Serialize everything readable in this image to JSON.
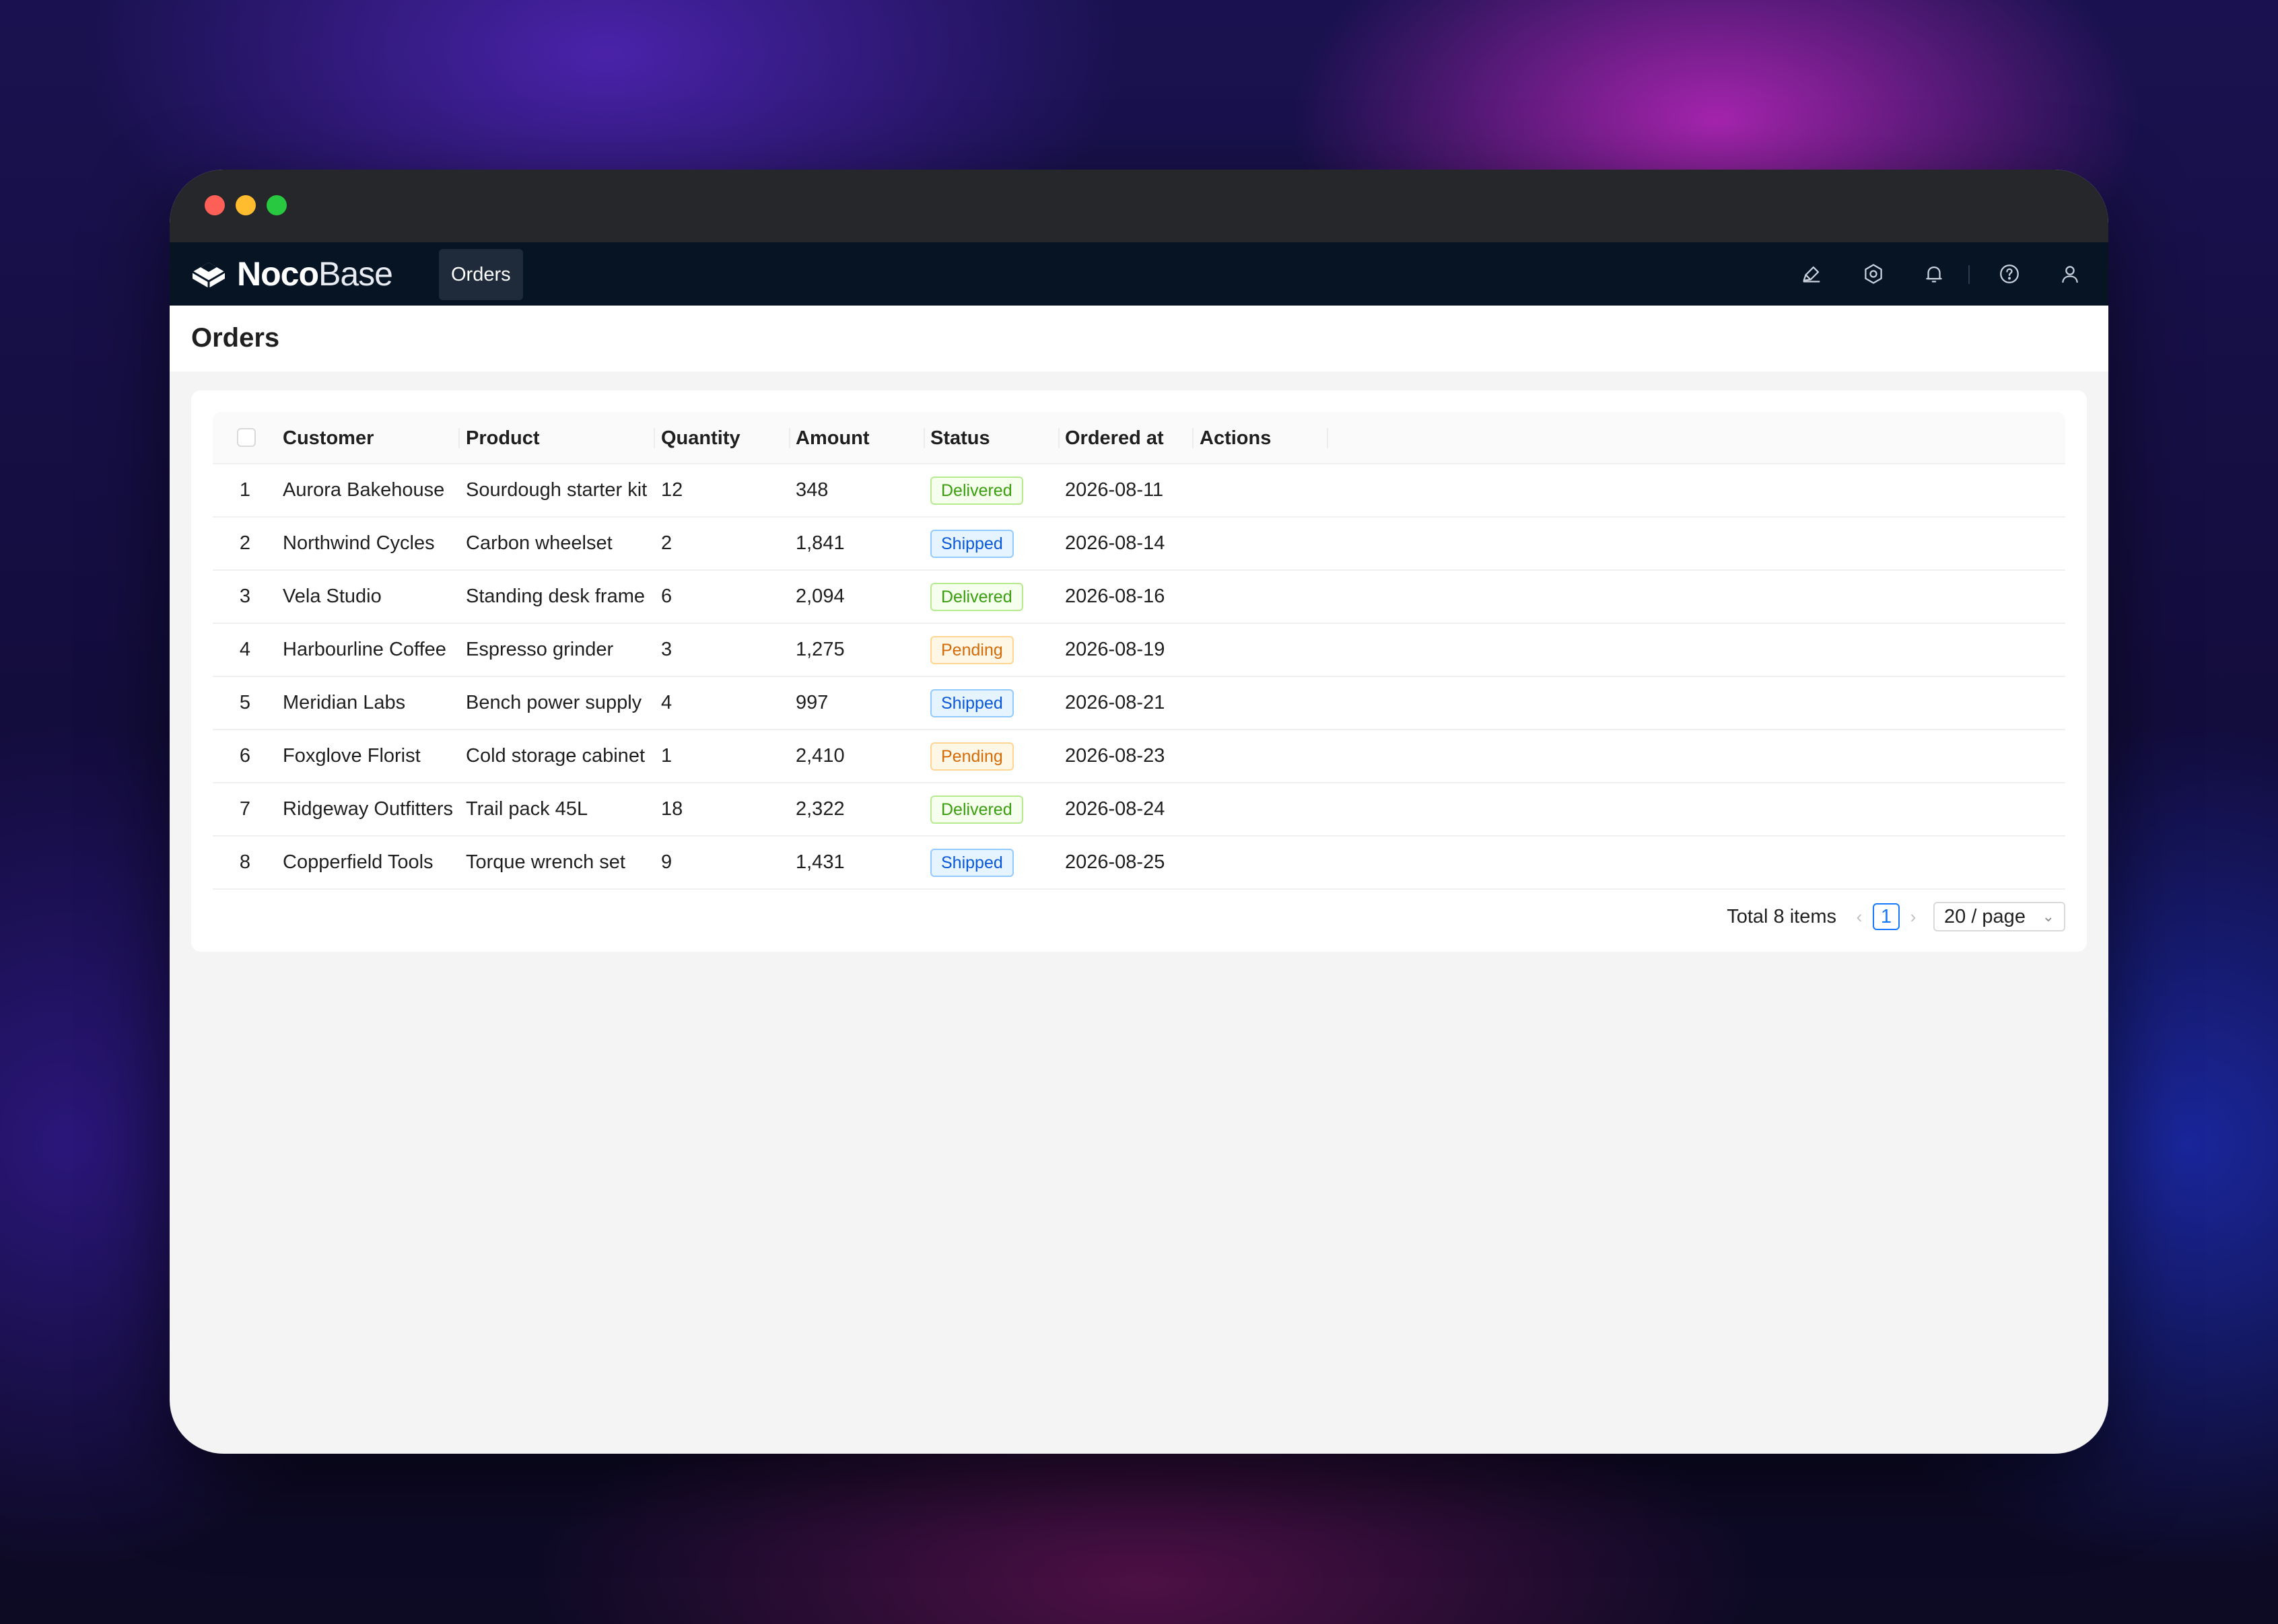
{
  "app": {
    "logo_noco": "Noco",
    "logo_base": "Base",
    "nav_tab": "Orders",
    "icons": [
      "brush-icon",
      "gear-icon",
      "bell-icon",
      "help-icon",
      "user-icon"
    ]
  },
  "page": {
    "title": "Orders"
  },
  "table": {
    "columns": [
      "Customer",
      "Product",
      "Quantity",
      "Amount",
      "Status",
      "Ordered at",
      "Actions"
    ],
    "rows": [
      {
        "index": "1",
        "customer": "Aurora Bakehouse",
        "product": "Sourdough starter kit",
        "quantity": "12",
        "amount": "348",
        "status": "Delivered",
        "ordered_at": "2026-08-11"
      },
      {
        "index": "2",
        "customer": "Northwind Cycles",
        "product": "Carbon wheelset",
        "quantity": "2",
        "amount": "1,841",
        "status": "Shipped",
        "ordered_at": "2026-08-14"
      },
      {
        "index": "3",
        "customer": "Vela Studio",
        "product": "Standing desk frame",
        "quantity": "6",
        "amount": "2,094",
        "status": "Delivered",
        "ordered_at": "2026-08-16"
      },
      {
        "index": "4",
        "customer": "Harbourline Coffee",
        "product": "Espresso grinder",
        "quantity": "3",
        "amount": "1,275",
        "status": "Pending",
        "ordered_at": "2026-08-19"
      },
      {
        "index": "5",
        "customer": "Meridian Labs",
        "product": "Bench power supply",
        "quantity": "4",
        "amount": "997",
        "status": "Shipped",
        "ordered_at": "2026-08-21"
      },
      {
        "index": "6",
        "customer": "Foxglove Florist",
        "product": "Cold storage cabinet",
        "quantity": "1",
        "amount": "2,410",
        "status": "Pending",
        "ordered_at": "2026-08-23"
      },
      {
        "index": "7",
        "customer": "Ridgeway Outfitters",
        "product": "Trail pack 45L",
        "quantity": "18",
        "amount": "2,322",
        "status": "Delivered",
        "ordered_at": "2026-08-24"
      },
      {
        "index": "8",
        "customer": "Copperfield Tools",
        "product": "Torque wrench set",
        "quantity": "9",
        "amount": "1,431",
        "status": "Shipped",
        "ordered_at": "2026-08-25"
      }
    ]
  },
  "pagination": {
    "total": "Total 8 items",
    "current_page": "1",
    "page_size": "20 / page"
  },
  "colors": {
    "delivered": "#389e0d",
    "shipped": "#0958d9",
    "pending": "#d46b08",
    "primary": "#1677ff"
  }
}
